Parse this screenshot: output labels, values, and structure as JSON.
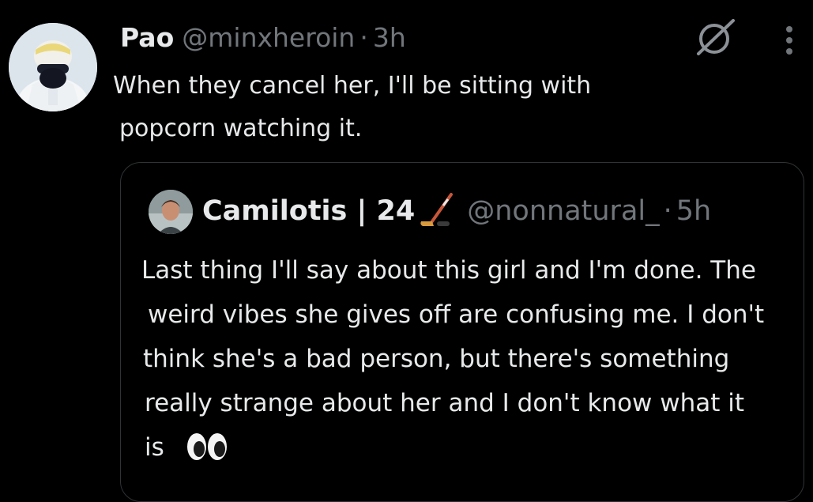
{
  "tweet": {
    "display_name": "Pao",
    "handle": "@minxheroin",
    "separator": "·",
    "time": "3h",
    "text_lines": [
      "When they cancel her, I'll be sitting with",
      "popcorn watching it."
    ],
    "icons": {
      "avatar": "profile-photo",
      "grok": "grok-icon",
      "more": "more-vertical-icon"
    }
  },
  "quote": {
    "display_name": "Camilotis | 24",
    "name_emoji": "hockey-stick-emoji",
    "handle": "@nonnatural_",
    "separator": "·",
    "time": "5h",
    "text_lines": [
      "Last thing I'll say about this girl and I'm done. The",
      "weird vibes she gives off are confusing me. I don't",
      "think she's a bad person, but there's something",
      "really strange about her and I don't know what it",
      "is"
    ],
    "trailing_emoji": "eyes-emoji"
  },
  "colors": {
    "background": "#000000",
    "text_primary": "#e7e9ea",
    "text_secondary": "#71767b",
    "border": "#2f3336"
  }
}
